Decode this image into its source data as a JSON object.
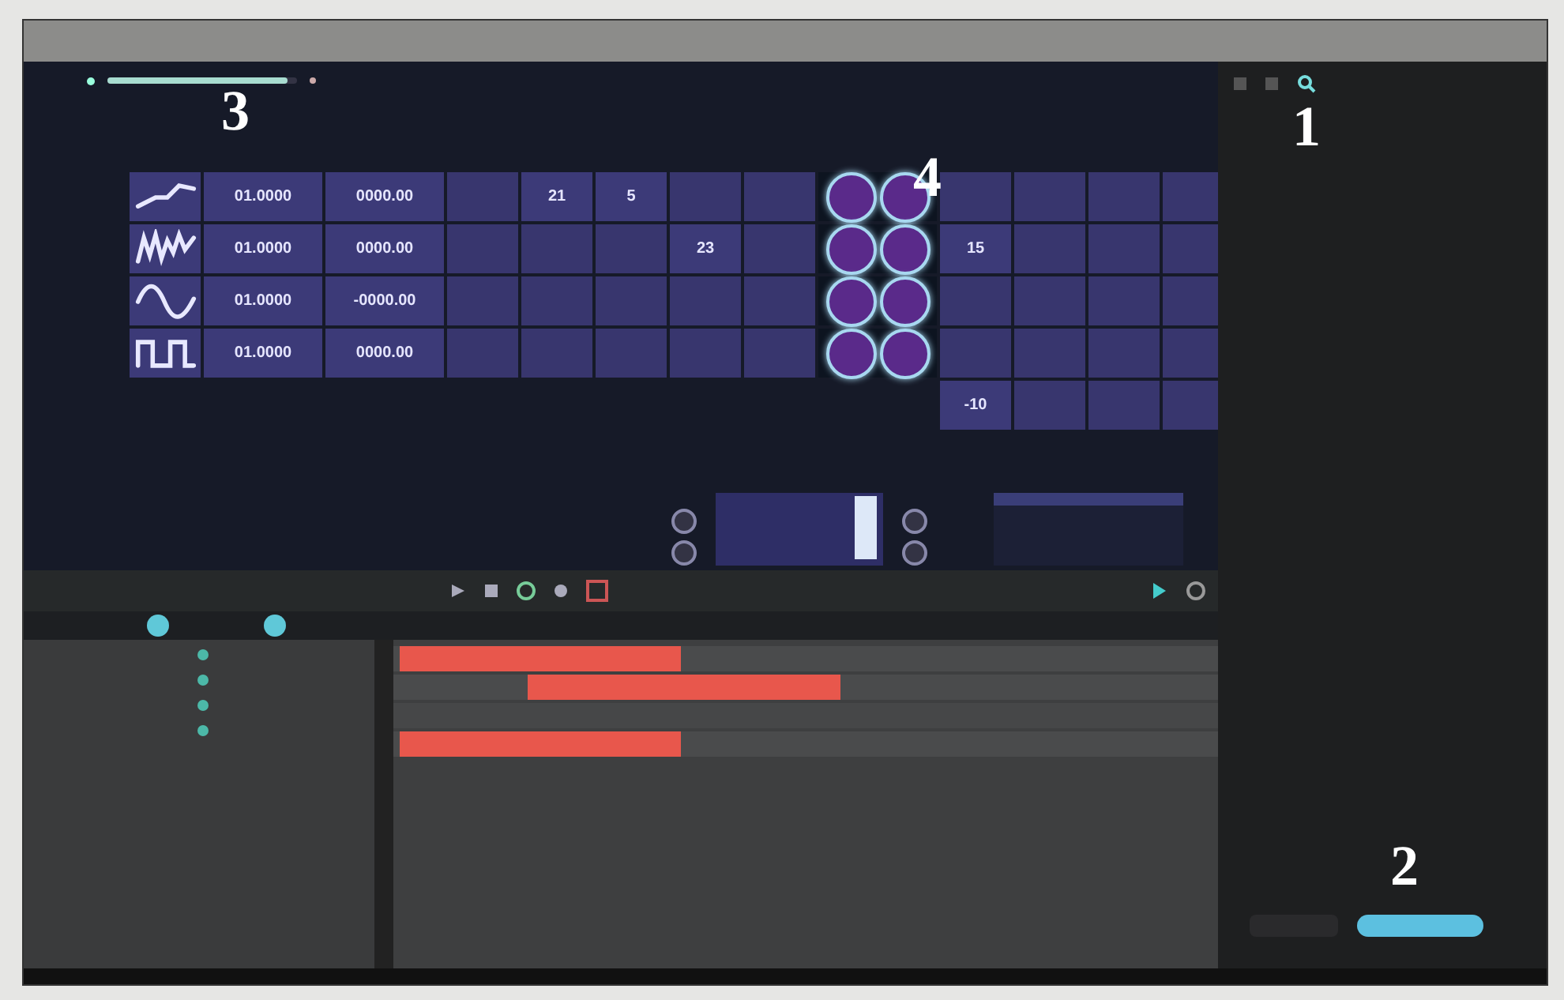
{
  "toolbar": {
    "zoom_slider": {
      "level": 0.95
    }
  },
  "grid": {
    "rows": [
      {
        "kind": "ramp",
        "value_1": "01.0000",
        "value_2": "0000.00",
        "cells": [
          {
            "kind": "empty"
          },
          {
            "kind": "value",
            "text": "21"
          },
          {
            "kind": "value",
            "text": "5"
          },
          {
            "kind": "empty"
          },
          {
            "kind": "empty"
          },
          {
            "kind": "knobs"
          },
          {
            "kind": "empty"
          },
          {
            "kind": "empty"
          },
          {
            "kind": "empty"
          },
          {
            "kind": "empty"
          }
        ]
      },
      {
        "kind": "noise",
        "value_1": "01.0000",
        "value_2": "0000.00",
        "cells": [
          {
            "kind": "empty"
          },
          {
            "kind": "empty"
          },
          {
            "kind": "empty"
          },
          {
            "kind": "value",
            "text": "23"
          },
          {
            "kind": "empty"
          },
          {
            "kind": "knobs"
          },
          {
            "kind": "value",
            "text": "15"
          },
          {
            "kind": "empty"
          },
          {
            "kind": "empty"
          },
          {
            "kind": "empty"
          }
        ]
      },
      {
        "kind": "sine",
        "value_1": "01.0000",
        "value_2": "-0000.00",
        "cells": [
          {
            "kind": "empty"
          },
          {
            "kind": "empty"
          },
          {
            "kind": "empty"
          },
          {
            "kind": "empty"
          },
          {
            "kind": "empty"
          },
          {
            "kind": "knobs"
          },
          {
            "kind": "empty"
          },
          {
            "kind": "empty"
          },
          {
            "kind": "empty"
          },
          {
            "kind": "empty"
          }
        ]
      },
      {
        "kind": "square",
        "value_1": "01.0000",
        "value_2": "0000.00",
        "cells": [
          {
            "kind": "empty"
          },
          {
            "kind": "empty"
          },
          {
            "kind": "empty"
          },
          {
            "kind": "empty"
          },
          {
            "kind": "empty"
          },
          {
            "kind": "knobs"
          },
          {
            "kind": "empty"
          },
          {
            "kind": "empty"
          },
          {
            "kind": "empty"
          },
          {
            "kind": "empty"
          }
        ]
      }
    ],
    "extra_row": [
      {
        "kind": "value",
        "text": "-10"
      },
      {
        "kind": "empty"
      },
      {
        "kind": "empty"
      },
      {
        "kind": "empty"
      }
    ]
  },
  "tracks": [
    {
      "clip": true
    },
    {
      "clip": true
    },
    {
      "clip": false
    },
    {
      "clip": true
    }
  ],
  "callouts": [
    {
      "text": "3"
    },
    {
      "text": "1"
    },
    {
      "text": "4"
    },
    {
      "text": "2"
    }
  ]
}
